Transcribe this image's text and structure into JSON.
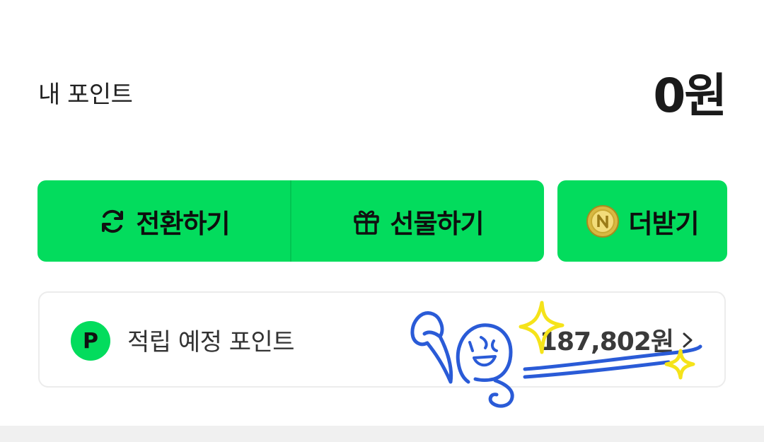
{
  "points": {
    "label": "내 포인트",
    "value": "0원"
  },
  "actions": {
    "convert": {
      "label": "전환하기",
      "icon": "refresh-icon"
    },
    "gift": {
      "label": "선물하기",
      "icon": "gift-icon"
    },
    "more": {
      "label": "더받기",
      "icon": "n-coin-icon"
    }
  },
  "pending": {
    "badge": "P",
    "label": "적립 예정 포인트",
    "amount": "187,802원",
    "icon": "chevron-right-icon"
  },
  "colors": {
    "brand_green": "#03dc5d",
    "doodle_blue": "#2a5bd7",
    "doodle_yellow": "#f5e31a"
  }
}
